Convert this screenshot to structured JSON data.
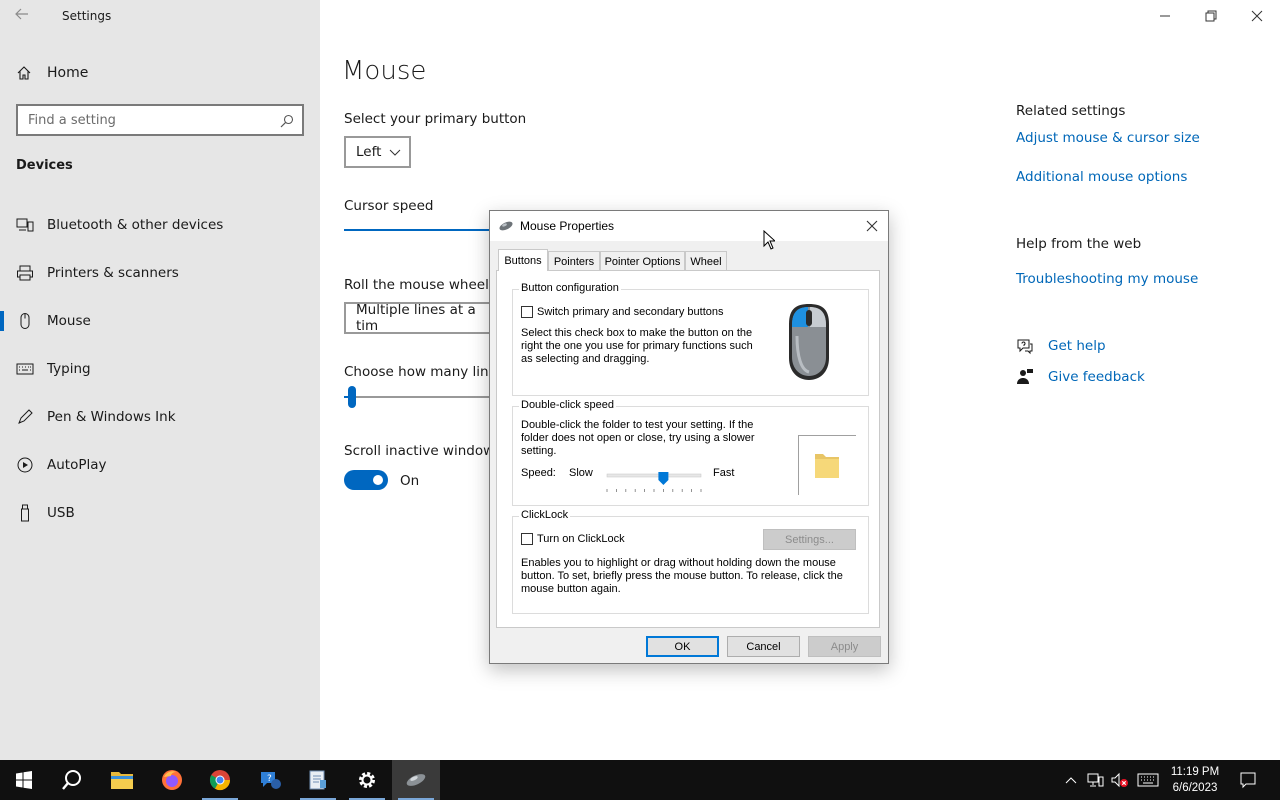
{
  "app": {
    "title": "Settings"
  },
  "sidebar": {
    "home_label": "Home",
    "search_placeholder": "Find a setting",
    "section_title": "Devices",
    "items": [
      {
        "label": "Bluetooth & other devices",
        "icon": "bluetooth-devices-icon"
      },
      {
        "label": "Printers & scanners",
        "icon": "printer-icon"
      },
      {
        "label": "Mouse",
        "icon": "mouse-icon",
        "active": true
      },
      {
        "label": "Typing",
        "icon": "keyboard-icon"
      },
      {
        "label": "Pen & Windows Ink",
        "icon": "pen-icon"
      },
      {
        "label": "AutoPlay",
        "icon": "autoplay-icon"
      },
      {
        "label": "USB",
        "icon": "usb-icon"
      }
    ]
  },
  "main": {
    "title": "Mouse",
    "primary_button_label": "Select your primary button",
    "primary_button_value": "Left",
    "cursor_speed_label": "Cursor speed",
    "roll_wheel_label": "Roll the mouse wheel to",
    "roll_wheel_value": "Multiple lines at a tim",
    "lines_label": "Choose how many lines",
    "scroll_inactive_label": "Scroll inactive windows",
    "scroll_inactive_state": "On",
    "accent_color": "#0067c0"
  },
  "related": {
    "title": "Related settings",
    "links": [
      "Adjust mouse & cursor size",
      "Additional mouse options"
    ],
    "help_title": "Help from the web",
    "help_links": [
      "Troubleshooting my mouse"
    ],
    "get_help": "Get help",
    "give_feedback": "Give feedback"
  },
  "dialog": {
    "title": "Mouse Properties",
    "tabs": [
      "Buttons",
      "Pointers",
      "Pointer Options",
      "Wheel"
    ],
    "active_tab": "Buttons",
    "button_config": {
      "title": "Button configuration",
      "switch_label": "Switch primary and secondary buttons",
      "switch_checked": false,
      "desc_lines": [
        "Select this check box to make the button on the",
        "right the one you use for primary functions such",
        "as selecting and dragging."
      ]
    },
    "double_click": {
      "title": "Double-click speed",
      "desc_lines": [
        "Double-click the folder to test your setting. If the",
        "folder does not open or close, try using a slower",
        "setting."
      ],
      "speed_label": "Speed:",
      "slow_label": "Slow",
      "fast_label": "Fast",
      "speed_fraction": 0.6
    },
    "clicklock": {
      "title": "ClickLock",
      "toggle_label": "Turn on ClickLock",
      "checked": false,
      "settings_button": "Settings...",
      "desc_lines": [
        "Enables you to highlight or drag without holding down the mouse",
        "button. To set, briefly press the mouse button. To release, click the",
        "mouse button again."
      ]
    },
    "buttons": {
      "ok": "OK",
      "cancel": "Cancel",
      "apply": "Apply"
    }
  },
  "taskbar": {
    "time": "11:19 PM",
    "date": "6/6/2023",
    "apps": [
      "start-icon",
      "search-icon",
      "file-explorer-icon",
      "firefox-icon",
      "chrome-icon",
      "help-icon",
      "notepad-icon",
      "settings-icon",
      "mouse-properties-icon"
    ]
  }
}
